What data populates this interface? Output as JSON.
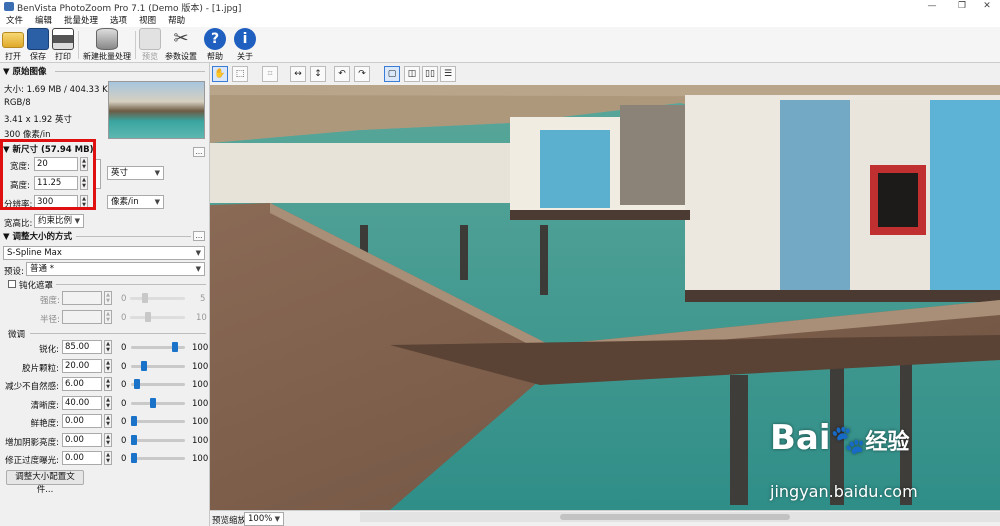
{
  "window": {
    "title": "BenVista PhotoZoom Pro 7.1 (Demo 版本) - [1.jpg]"
  },
  "menu": [
    "文件",
    "编辑",
    "批量处理",
    "选项",
    "视图",
    "帮助"
  ],
  "toolbar": {
    "open": "打开",
    "save": "保存",
    "print": "打印",
    "new_batch": "新建批量处理",
    "preview": "预览",
    "params": "参数设置",
    "help": "帮助",
    "about": "关于"
  },
  "original": {
    "header": "▼ 原始图像",
    "size": "大小: 1.69 MB / 404.33 KB",
    "mode": "RGB/8",
    "dims": "3.41 x 1.92 英寸",
    "res": "300 像素/in"
  },
  "newsize": {
    "header": "▼ 新尺寸 (57.94 MB)",
    "width_label": "宽度:",
    "width": "20",
    "height_label": "高度:",
    "height": "11.25",
    "res_label": "分辨率:",
    "res": "300",
    "unit": "英寸",
    "res_unit": "像素/in",
    "aspect_label": "宽高比:",
    "aspect": "约束比例"
  },
  "method": {
    "header": "▼ 调整大小的方式",
    "algorithm": "S-Spline Max",
    "preset_label": "预设:",
    "preset": "普通 *",
    "unsharp_label": "钝化遮罩",
    "strength_label": "强度:",
    "radius_label": "半径:",
    "micro_label": "微调",
    "buttons_dots": "..."
  },
  "sliders": [
    {
      "label": "锐化:",
      "value": "85.00",
      "min": "0",
      "max": "100",
      "level": 0.85
    },
    {
      "label": "胶片颗粒:",
      "value": "20.00",
      "min": "0",
      "max": "100",
      "level": 0.2
    },
    {
      "label": "减少不自然感:",
      "value": "6.00",
      "min": "0",
      "max": "100",
      "level": 0.06
    },
    {
      "label": "清晰度:",
      "value": "40.00",
      "min": "0",
      "max": "100",
      "level": 0.4
    },
    {
      "label": "鲜艳度:",
      "value": "0.00",
      "min": "0",
      "max": "100",
      "level": 0.0
    },
    {
      "label": "增加阴影亮度:",
      "value": "0.00",
      "min": "0",
      "max": "100",
      "level": 0.0
    },
    {
      "label": "修正过度曝光:",
      "value": "0.00",
      "min": "0",
      "max": "100",
      "level": 0.0
    }
  ],
  "unsharp": {
    "strength_min": "0",
    "strength_max": "5",
    "radius_min": "0",
    "radius_max": "10"
  },
  "profile_button": "调整大小配置文件...",
  "status": {
    "zoom_label": "预览缩放:",
    "zoom": "100%"
  },
  "watermark": {
    "brand": "Bai",
    "brand2": "经验",
    "url": "jingyan.baidu.com"
  },
  "colors": {
    "accent": "#1a73c9",
    "highlight": "#e01010"
  }
}
